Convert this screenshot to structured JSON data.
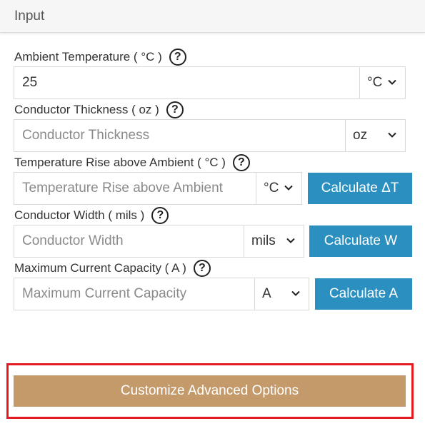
{
  "panel": {
    "title": "Input"
  },
  "fields": [
    {
      "label": "Ambient Temperature ( °C )",
      "value": "25",
      "placeholder": "",
      "unit": "°C"
    },
    {
      "label": "Conductor Thickness ( oz )",
      "value": "",
      "placeholder": "Conductor Thickness",
      "unit": "oz"
    },
    {
      "label": "Temperature Rise above Ambient ( °C )",
      "value": "",
      "placeholder": "Temperature Rise above Ambient",
      "unit": "°C",
      "button": "Calculate ΔT"
    },
    {
      "label": "Conductor Width ( mils )",
      "value": "",
      "placeholder": "Conductor Width",
      "unit": "mils",
      "button": "Calculate W"
    },
    {
      "label": "Maximum Current Capacity ( A )",
      "value": "",
      "placeholder": "Maximum Current Capacity",
      "unit": "A",
      "button": "Calculate A"
    }
  ],
  "help_symbol": "?",
  "advanced": {
    "label": "Customize Advanced Options",
    "highlight_color": "#e31b23"
  },
  "colors": {
    "calculate_button": "#2b8fc0",
    "advanced_button": "#c59a6b",
    "border": "#d9d9d9"
  }
}
